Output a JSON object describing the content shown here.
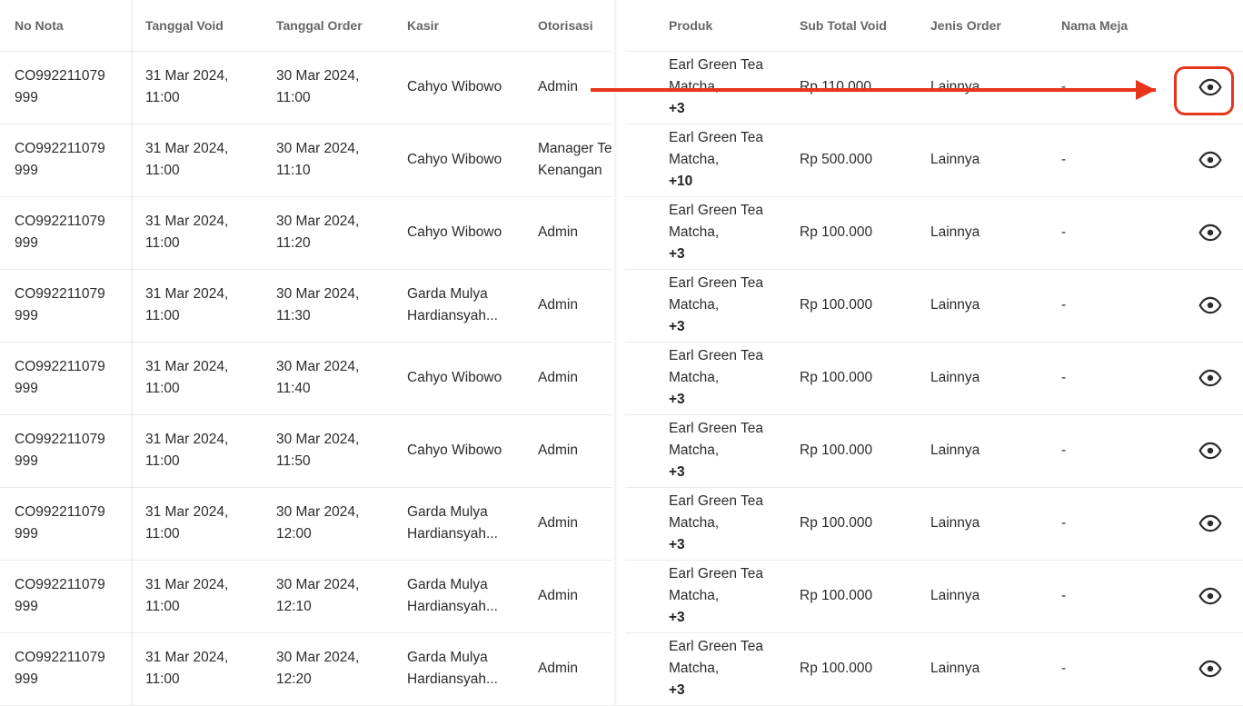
{
  "headers": {
    "no_nota": "No Nota",
    "tanggal_void": "Tanggal Void",
    "tanggal_order": "Tanggal Order",
    "kasir": "Kasir",
    "otorisasi": "Otorisasi",
    "produk": "Produk",
    "sub_total_void": "Sub Total Void",
    "jenis_order": "Jenis Order",
    "nama_meja": "Nama Meja"
  },
  "rows": [
    {
      "nota_1": "CO992211079",
      "nota_2": "999",
      "void_1": "31 Mar 2024,",
      "void_2": "11:00",
      "order_1": "30 Mar 2024,",
      "order_2": "11:00",
      "kasir_1": "Cahyo Wibowo",
      "kasir_2": "",
      "otor_1": "Admin",
      "otor_2": "",
      "prod_1": "Earl Green Tea",
      "prod_2": "Matcha, ",
      "prod_more": "+3",
      "sub": "Rp 110.000",
      "jenis": "Lainnya",
      "meja": "-"
    },
    {
      "nota_1": "CO992211079",
      "nota_2": "999",
      "void_1": "31 Mar 2024,",
      "void_2": "11:00",
      "order_1": "30 Mar 2024,",
      "order_2": "11:10",
      "kasir_1": "Cahyo Wibowo",
      "kasir_2": "",
      "otor_1": "Manager Te",
      "otor_2": "Kenangan",
      "prod_1": "Earl Green Tea",
      "prod_2": "Matcha, ",
      "prod_more": "+10",
      "sub": "Rp 500.000",
      "jenis": "Lainnya",
      "meja": "-"
    },
    {
      "nota_1": "CO992211079",
      "nota_2": "999",
      "void_1": "31 Mar 2024,",
      "void_2": "11:00",
      "order_1": "30 Mar 2024,",
      "order_2": "11:20",
      "kasir_1": "Cahyo Wibowo",
      "kasir_2": "",
      "otor_1": "Admin",
      "otor_2": "",
      "prod_1": "Earl Green Tea",
      "prod_2": "Matcha, ",
      "prod_more": "+3",
      "sub": "Rp 100.000",
      "jenis": "Lainnya",
      "meja": "-"
    },
    {
      "nota_1": "CO992211079",
      "nota_2": "999",
      "void_1": "31 Mar 2024,",
      "void_2": "11:00",
      "order_1": "30 Mar 2024,",
      "order_2": "11:30",
      "kasir_1": "Garda Mulya",
      "kasir_2": "Hardiansyah...",
      "otor_1": "Admin",
      "otor_2": "",
      "prod_1": "Earl Green Tea",
      "prod_2": "Matcha, ",
      "prod_more": "+3",
      "sub": "Rp 100.000",
      "jenis": "Lainnya",
      "meja": "-"
    },
    {
      "nota_1": "CO992211079",
      "nota_2": "999",
      "void_1": "31 Mar 2024,",
      "void_2": "11:00",
      "order_1": "30 Mar 2024,",
      "order_2": "11:40",
      "kasir_1": "Cahyo Wibowo",
      "kasir_2": "",
      "otor_1": "Admin",
      "otor_2": "",
      "prod_1": "Earl Green Tea",
      "prod_2": "Matcha, ",
      "prod_more": "+3",
      "sub": "Rp 100.000",
      "jenis": "Lainnya",
      "meja": "-"
    },
    {
      "nota_1": "CO992211079",
      "nota_2": "999",
      "void_1": "31 Mar 2024,",
      "void_2": "11:00",
      "order_1": "30 Mar 2024,",
      "order_2": "11:50",
      "kasir_1": "Cahyo Wibowo",
      "kasir_2": "",
      "otor_1": "Admin",
      "otor_2": "",
      "prod_1": "Earl Green Tea",
      "prod_2": "Matcha, ",
      "prod_more": "+3",
      "sub": "Rp 100.000",
      "jenis": "Lainnya",
      "meja": "-"
    },
    {
      "nota_1": "CO992211079",
      "nota_2": "999",
      "void_1": "31 Mar 2024,",
      "void_2": "11:00",
      "order_1": "30 Mar 2024,",
      "order_2": "12:00",
      "kasir_1": "Garda Mulya",
      "kasir_2": "Hardiansyah...",
      "otor_1": "Admin",
      "otor_2": "",
      "prod_1": "Earl Green Tea",
      "prod_2": "Matcha, ",
      "prod_more": "+3",
      "sub": "Rp 100.000",
      "jenis": "Lainnya",
      "meja": "-"
    },
    {
      "nota_1": "CO992211079",
      "nota_2": "999",
      "void_1": "31 Mar 2024,",
      "void_2": "11:00",
      "order_1": "30 Mar 2024,",
      "order_2": "12:10",
      "kasir_1": "Garda Mulya",
      "kasir_2": "Hardiansyah...",
      "otor_1": "Admin",
      "otor_2": "",
      "prod_1": "Earl Green Tea",
      "prod_2": "Matcha, ",
      "prod_more": "+3",
      "sub": "Rp 100.000",
      "jenis": "Lainnya",
      "meja": "-"
    },
    {
      "nota_1": "CO992211079",
      "nota_2": "999",
      "void_1": "31 Mar 2024,",
      "void_2": "11:00",
      "order_1": "30 Mar 2024,",
      "order_2": "12:20",
      "kasir_1": "Garda Mulya",
      "kasir_2": "Hardiansyah...",
      "otor_1": "Admin",
      "otor_2": "",
      "prod_1": "Earl Green Tea",
      "prod_2": "Matcha, ",
      "prod_more": "+3",
      "sub": "Rp 100.000",
      "jenis": "Lainnya",
      "meja": "-"
    }
  ],
  "row_action_icon": "eye-icon",
  "annotation": {
    "color": "#e8341c",
    "highlighted_row": 0
  }
}
